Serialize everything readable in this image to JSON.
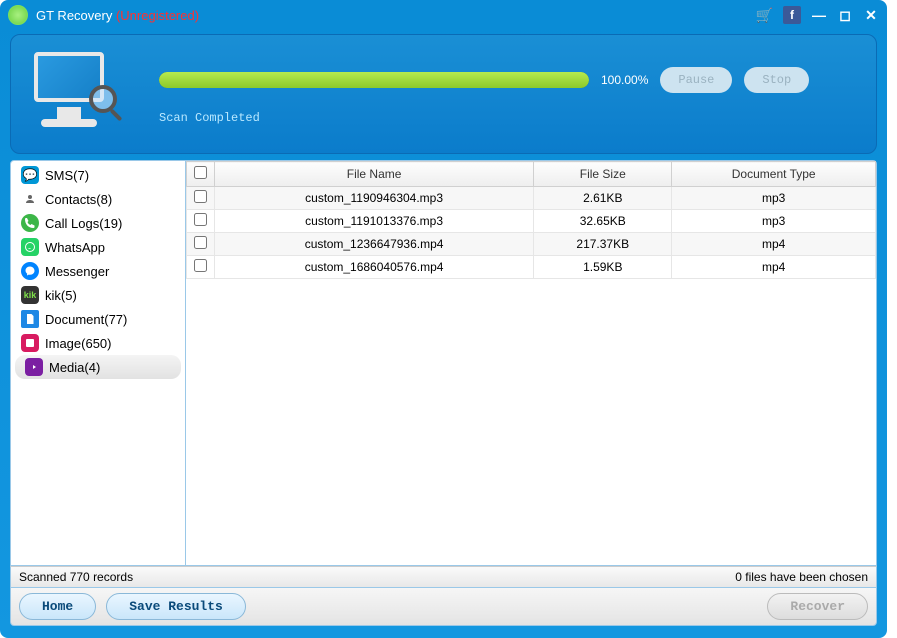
{
  "title": {
    "app": "GT Recovery",
    "status": "(Unregistered)"
  },
  "header": {
    "progress_pct": "100.00%",
    "pause_label": "Pause",
    "stop_label": "Stop",
    "status_line": "Scan Completed"
  },
  "sidebar": {
    "items": [
      {
        "label": "SMS(7)",
        "icon": "sms",
        "selected": false
      },
      {
        "label": "Contacts(8)",
        "icon": "contacts",
        "selected": false
      },
      {
        "label": "Call Logs(19)",
        "icon": "calls",
        "selected": false
      },
      {
        "label": "WhatsApp",
        "icon": "whatsapp",
        "selected": false
      },
      {
        "label": "Messenger",
        "icon": "messenger",
        "selected": false
      },
      {
        "label": "kik(5)",
        "icon": "kik",
        "selected": false
      },
      {
        "label": "Document(77)",
        "icon": "document",
        "selected": false
      },
      {
        "label": "Image(650)",
        "icon": "image",
        "selected": false
      },
      {
        "label": "Media(4)",
        "icon": "media",
        "selected": true
      }
    ]
  },
  "table": {
    "columns": [
      "File Name",
      "File Size",
      "Document Type"
    ],
    "rows": [
      {
        "name": "custom_1190946304.mp3",
        "size": "2.61KB",
        "type": "mp3"
      },
      {
        "name": "custom_1191013376.mp3",
        "size": "32.65KB",
        "type": "mp3"
      },
      {
        "name": "custom_1236647936.mp4",
        "size": "217.37KB",
        "type": "mp4"
      },
      {
        "name": "custom_1686040576.mp4",
        "size": "1.59KB",
        "type": "mp4"
      }
    ]
  },
  "statusbar": {
    "left": "Scanned 770 records",
    "right": "0 files have been chosen"
  },
  "footer": {
    "home_label": "Home",
    "save_label": "Save Results",
    "recover_label": "Recover"
  }
}
